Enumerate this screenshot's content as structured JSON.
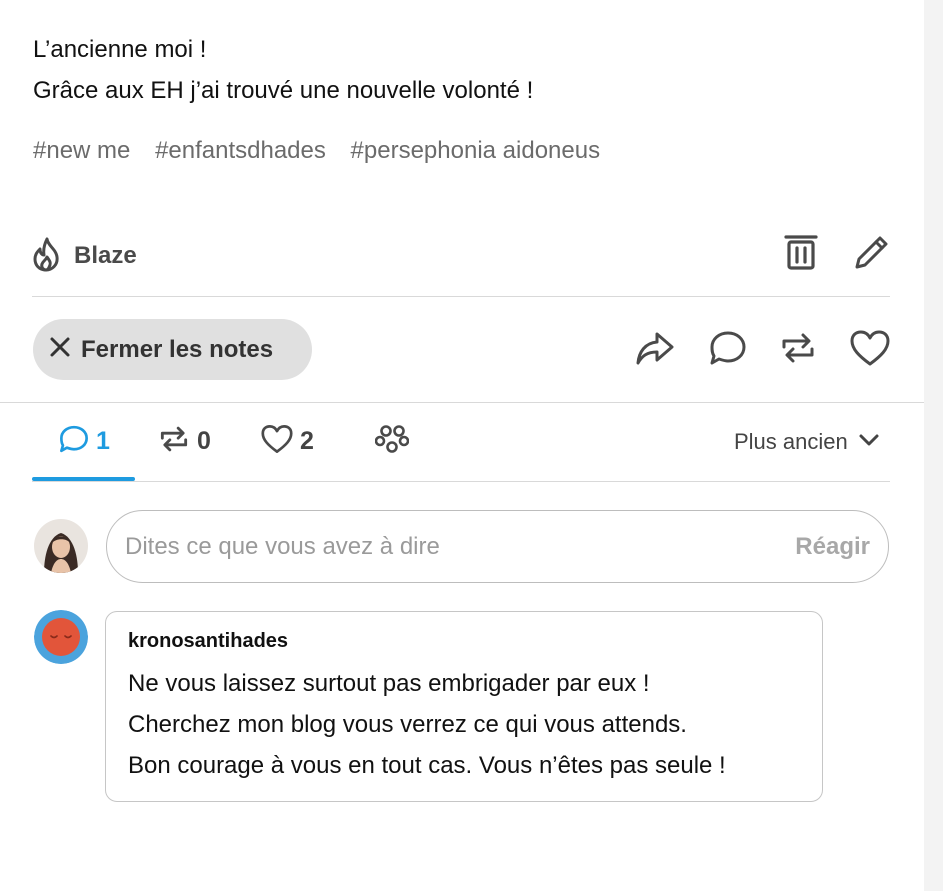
{
  "post": {
    "lines": [
      "L’ancienne moi !",
      "Grâce aux EH j’ai trouvé une nouvelle volonté !"
    ],
    "tags": [
      "#new me",
      "#enfantsdhades",
      "#persephonia aidoneus"
    ]
  },
  "actions": {
    "blaze_label": "Blaze",
    "icons": [
      "flame-icon",
      "trash-icon",
      "pencil-icon"
    ]
  },
  "notes_bar": {
    "close_label": "Fermer les notes",
    "icons": [
      "share-icon",
      "comment-icon",
      "reblog-icon",
      "heart-icon"
    ]
  },
  "tabs": {
    "replies_count": "1",
    "reblogs_count": "0",
    "likes_count": "2",
    "sort_label": "Plus ancien",
    "active": "replies"
  },
  "reply_box": {
    "placeholder": "Dites ce que vous avez à dire",
    "submit_label": "Réagir"
  },
  "notes": [
    {
      "username": "kronosantihades",
      "lines": [
        "Ne vous laissez surtout pas embrigader par eux !",
        "Cherchez mon blog vous verrez ce qui vous attends.",
        "Bon courage à vous en tout cas. Vous n’êtes pas seule !"
      ]
    }
  ],
  "colors": {
    "accent": "#1e9be0",
    "tag_text": "#6b6b6b",
    "pill_bg": "#e0e0e0",
    "note_avatar_bg": "#4ba3dd",
    "note_avatar_fg": "#e2553a"
  }
}
